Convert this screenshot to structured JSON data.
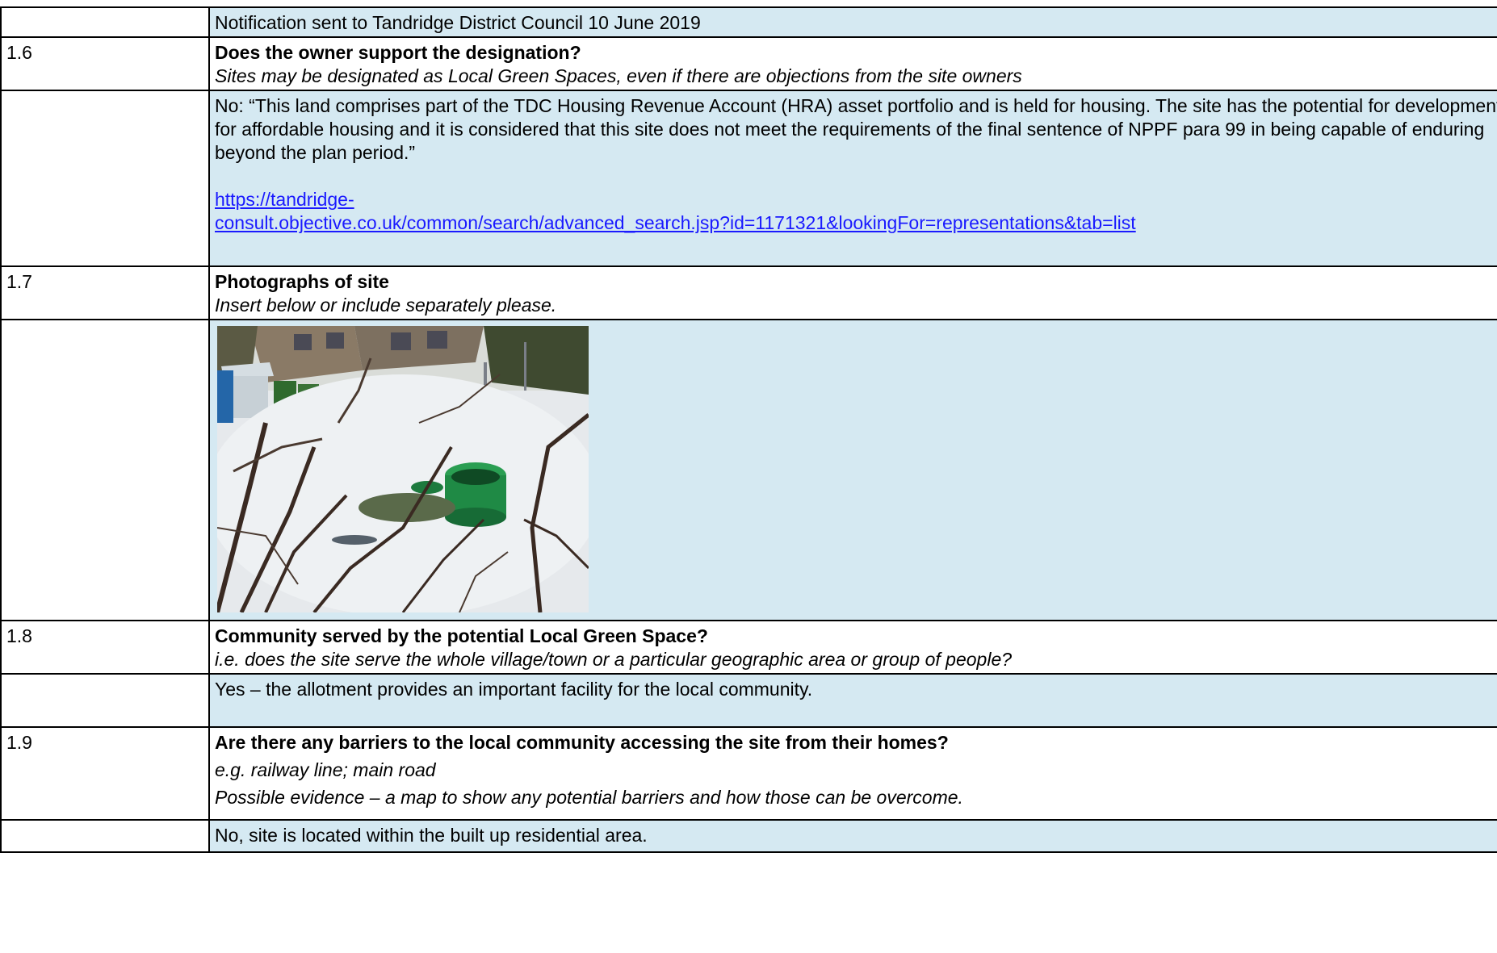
{
  "rows": {
    "r0": {
      "answer": "Notification sent to Tandridge District Council 10 June 2019"
    },
    "r16": {
      "num": "1.6",
      "question": "Does the owner support the designation?",
      "guidance": "Sites may be designated as Local Green Spaces, even if there are objections from the site owners",
      "answer": "No: “This land comprises part of the TDC Housing Revenue Account (HRA) asset portfolio and is held for housing. The site has the potential for development for affordable housing and it is considered that this site does not meet the requirements of the final sentence of NPPF para 99 in being capable of enduring beyond the plan period.”",
      "link_line1": "https://tandridge-",
      "link_line2": "consult.objective.co.uk/common/search/advanced_search.jsp?id=1171321&lookingFor=representations&tab=list"
    },
    "r17": {
      "num": "1.7",
      "question": "Photographs of site",
      "guidance": "Insert below or include separately please."
    },
    "r18": {
      "num": "1.8",
      "question": "Community served by the potential Local Green Space?",
      "guidance": "i.e. does the site serve the whole village/town or a particular geographic area or group of people?",
      "answer": "Yes – the allotment provides an important facility for the local community."
    },
    "r19": {
      "num": "1.9",
      "question": "Are there any barriers to the local community accessing the site from their homes?",
      "guidance1": "e.g. railway line; main road",
      "guidance2": "Possible evidence – a map to show any potential barriers and how those can be overcome.",
      "answer": "No, site is located within the built up residential area."
    }
  },
  "photo": {
    "subject": "snow-covered allotment with green water butts, shed and houses",
    "colors": {
      "snow": "#e9ecef",
      "butt": "#1f8a45",
      "house": "#8a7a66",
      "branch": "#3a2a22",
      "shed": "#d8dfe4"
    }
  }
}
